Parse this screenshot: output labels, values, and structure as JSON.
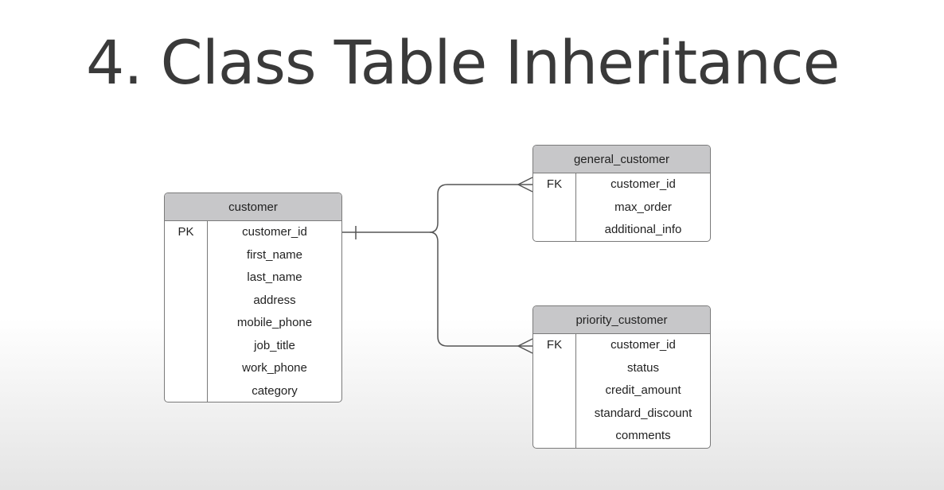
{
  "slide": {
    "title": "4. Class Table Inheritance"
  },
  "colors": {
    "header_fill": "#c7c7c9",
    "border": "#7a7a7a",
    "title_text": "#3a3a3a",
    "connector": "#555555"
  },
  "entities": {
    "customer": {
      "name": "customer",
      "rows": [
        {
          "key": "PK",
          "attr": "customer_id"
        },
        {
          "key": "",
          "attr": "first_name"
        },
        {
          "key": "",
          "attr": "last_name"
        },
        {
          "key": "",
          "attr": "address"
        },
        {
          "key": "",
          "attr": "mobile_phone"
        },
        {
          "key": "",
          "attr": "job_title"
        },
        {
          "key": "",
          "attr": "work_phone"
        },
        {
          "key": "",
          "attr": "category"
        }
      ]
    },
    "general_customer": {
      "name": "general_customer",
      "rows": [
        {
          "key": "FK",
          "attr": "customer_id"
        },
        {
          "key": "",
          "attr": "max_order"
        },
        {
          "key": "",
          "attr": "additional_info"
        }
      ]
    },
    "priority_customer": {
      "name": "priority_customer",
      "rows": [
        {
          "key": "FK",
          "attr": "customer_id"
        },
        {
          "key": "",
          "attr": "status"
        },
        {
          "key": "",
          "attr": "credit_amount"
        },
        {
          "key": "",
          "attr": "standard_discount"
        },
        {
          "key": "",
          "attr": "comments"
        }
      ]
    }
  },
  "relationships": [
    {
      "from": "customer",
      "to": "general_customer",
      "from_end": "one",
      "to_end": "many"
    },
    {
      "from": "customer",
      "to": "priority_customer",
      "from_end": "one",
      "to_end": "many"
    }
  ]
}
